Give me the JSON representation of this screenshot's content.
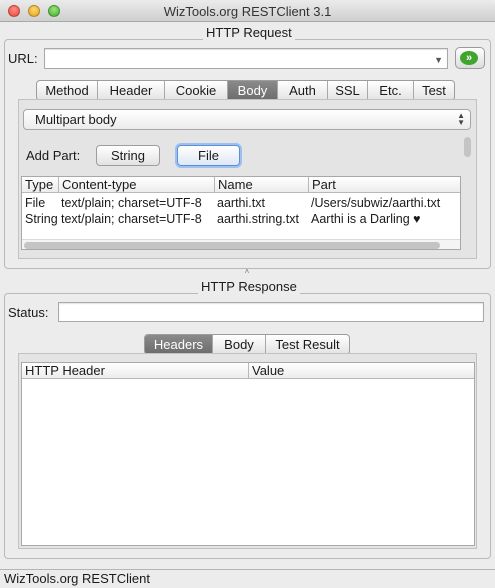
{
  "window": {
    "title": "WizTools.org RESTClient 3.1"
  },
  "request": {
    "group_title": "HTTP Request",
    "url_label": "URL:",
    "url_value": "",
    "go_icon": "double-chevron-right-icon",
    "tabs": [
      {
        "label": "Method"
      },
      {
        "label": "Header"
      },
      {
        "label": "Cookie"
      },
      {
        "label": "Body",
        "active": true
      },
      {
        "label": "Auth"
      },
      {
        "label": "SSL"
      },
      {
        "label": "Etc."
      },
      {
        "label": "Test"
      }
    ],
    "body_type": "Multipart body",
    "add_part_label": "Add Part:",
    "string_button": "String",
    "file_button": "File",
    "parts_table": {
      "headers": [
        "Type",
        "Content-type",
        "Name",
        "Part"
      ],
      "rows": [
        [
          "File",
          "text/plain; charset=UTF-8",
          "aarthi.txt",
          "/Users/subwiz/aarthi.txt"
        ],
        [
          "String",
          "text/plain; charset=UTF-8",
          "aarthi.string.txt",
          "Aarthi is a Darling ♥"
        ]
      ]
    }
  },
  "response": {
    "group_title": "HTTP Response",
    "status_label": "Status:",
    "status_value": "",
    "tabs": [
      {
        "label": "Headers",
        "active": true
      },
      {
        "label": "Body"
      },
      {
        "label": "Test Result"
      }
    ],
    "headers_table": {
      "headers": [
        "HTTP Header",
        "Value"
      ],
      "rows": []
    }
  },
  "statusbar": {
    "text": "WizTools.org RESTClient"
  },
  "colors": {
    "go_green": "#3ea52d",
    "active_tab": "#7a7a7a",
    "focus_blue": "#5b8fd8"
  }
}
